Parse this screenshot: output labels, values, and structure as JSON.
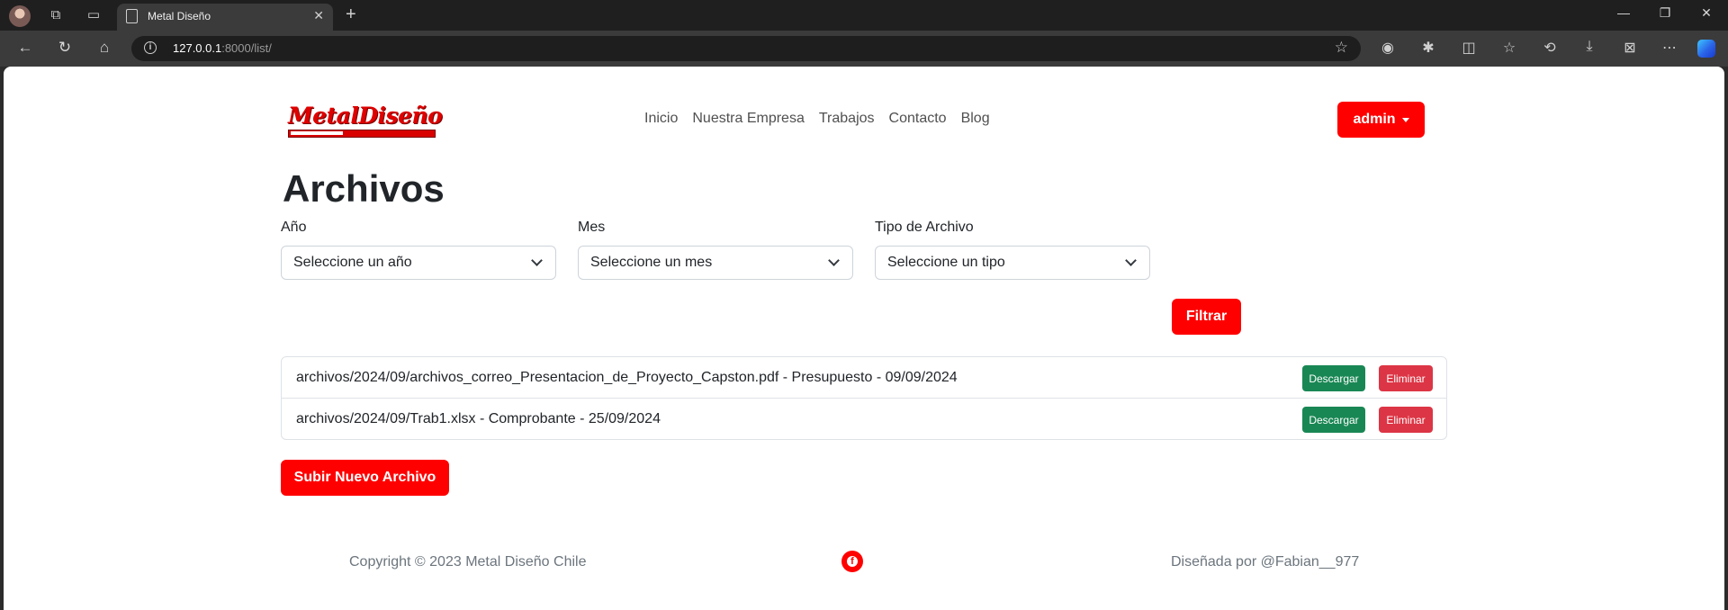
{
  "browser": {
    "tab_title": "Metal Diseño",
    "url_host": "127.0.0.1",
    "url_rest": ":8000/list/"
  },
  "site": {
    "logo_text": "MetalDiseño",
    "nav": [
      "Inicio",
      "Nuestra Empresa",
      "Trabajos",
      "Contacto",
      "Blog"
    ],
    "user_button": "admin"
  },
  "page": {
    "title": "Archivos",
    "filters": {
      "year_label": "Año",
      "year_value": "Seleccione un año",
      "month_label": "Mes",
      "month_value": "Seleccione un mes",
      "type_label": "Tipo de Archivo",
      "type_value": "Seleccione un tipo",
      "filter_button": "Filtrar"
    },
    "files": [
      {
        "text": "archivos/2024/09/archivos_correo_Presentacion_de_Proyecto_Capston.pdf - Presupuesto - 09/09/2024",
        "download": "Descargar",
        "delete": "Eliminar"
      },
      {
        "text": "archivos/2024/09/Trab1.xlsx - Comprobante - 25/09/2024",
        "download": "Descargar",
        "delete": "Eliminar"
      }
    ],
    "upload_button": "Subir Nuevo Archivo"
  },
  "footer": {
    "copyright": "Copyright © 2023 Metal Diseño Chile",
    "designer": "Diseñada por @Fabian__977"
  },
  "colors": {
    "brand_red": "#ff0000",
    "download_green": "#198754",
    "delete_red": "#dc3545"
  }
}
